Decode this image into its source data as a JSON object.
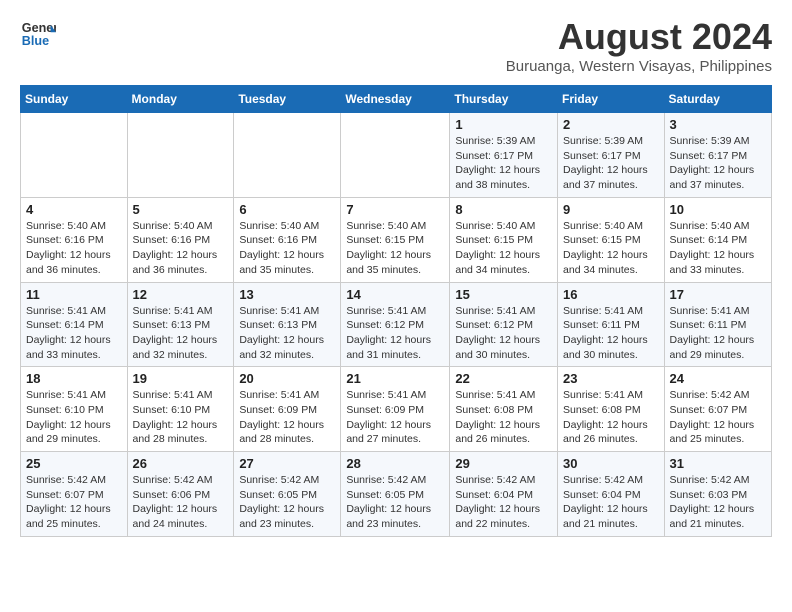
{
  "logo": {
    "line1": "General",
    "line2": "Blue"
  },
  "title": "August 2024",
  "subtitle": "Buruanga, Western Visayas, Philippines",
  "days_of_week": [
    "Sunday",
    "Monday",
    "Tuesday",
    "Wednesday",
    "Thursday",
    "Friday",
    "Saturday"
  ],
  "weeks": [
    [
      {
        "day": "",
        "info": ""
      },
      {
        "day": "",
        "info": ""
      },
      {
        "day": "",
        "info": ""
      },
      {
        "day": "",
        "info": ""
      },
      {
        "day": "1",
        "info": "Sunrise: 5:39 AM\nSunset: 6:17 PM\nDaylight: 12 hours\nand 38 minutes."
      },
      {
        "day": "2",
        "info": "Sunrise: 5:39 AM\nSunset: 6:17 PM\nDaylight: 12 hours\nand 37 minutes."
      },
      {
        "day": "3",
        "info": "Sunrise: 5:39 AM\nSunset: 6:17 PM\nDaylight: 12 hours\nand 37 minutes."
      }
    ],
    [
      {
        "day": "4",
        "info": "Sunrise: 5:40 AM\nSunset: 6:16 PM\nDaylight: 12 hours\nand 36 minutes."
      },
      {
        "day": "5",
        "info": "Sunrise: 5:40 AM\nSunset: 6:16 PM\nDaylight: 12 hours\nand 36 minutes."
      },
      {
        "day": "6",
        "info": "Sunrise: 5:40 AM\nSunset: 6:16 PM\nDaylight: 12 hours\nand 35 minutes."
      },
      {
        "day": "7",
        "info": "Sunrise: 5:40 AM\nSunset: 6:15 PM\nDaylight: 12 hours\nand 35 minutes."
      },
      {
        "day": "8",
        "info": "Sunrise: 5:40 AM\nSunset: 6:15 PM\nDaylight: 12 hours\nand 34 minutes."
      },
      {
        "day": "9",
        "info": "Sunrise: 5:40 AM\nSunset: 6:15 PM\nDaylight: 12 hours\nand 34 minutes."
      },
      {
        "day": "10",
        "info": "Sunrise: 5:40 AM\nSunset: 6:14 PM\nDaylight: 12 hours\nand 33 minutes."
      }
    ],
    [
      {
        "day": "11",
        "info": "Sunrise: 5:41 AM\nSunset: 6:14 PM\nDaylight: 12 hours\nand 33 minutes."
      },
      {
        "day": "12",
        "info": "Sunrise: 5:41 AM\nSunset: 6:13 PM\nDaylight: 12 hours\nand 32 minutes."
      },
      {
        "day": "13",
        "info": "Sunrise: 5:41 AM\nSunset: 6:13 PM\nDaylight: 12 hours\nand 32 minutes."
      },
      {
        "day": "14",
        "info": "Sunrise: 5:41 AM\nSunset: 6:12 PM\nDaylight: 12 hours\nand 31 minutes."
      },
      {
        "day": "15",
        "info": "Sunrise: 5:41 AM\nSunset: 6:12 PM\nDaylight: 12 hours\nand 30 minutes."
      },
      {
        "day": "16",
        "info": "Sunrise: 5:41 AM\nSunset: 6:11 PM\nDaylight: 12 hours\nand 30 minutes."
      },
      {
        "day": "17",
        "info": "Sunrise: 5:41 AM\nSunset: 6:11 PM\nDaylight: 12 hours\nand 29 minutes."
      }
    ],
    [
      {
        "day": "18",
        "info": "Sunrise: 5:41 AM\nSunset: 6:10 PM\nDaylight: 12 hours\nand 29 minutes."
      },
      {
        "day": "19",
        "info": "Sunrise: 5:41 AM\nSunset: 6:10 PM\nDaylight: 12 hours\nand 28 minutes."
      },
      {
        "day": "20",
        "info": "Sunrise: 5:41 AM\nSunset: 6:09 PM\nDaylight: 12 hours\nand 28 minutes."
      },
      {
        "day": "21",
        "info": "Sunrise: 5:41 AM\nSunset: 6:09 PM\nDaylight: 12 hours\nand 27 minutes."
      },
      {
        "day": "22",
        "info": "Sunrise: 5:41 AM\nSunset: 6:08 PM\nDaylight: 12 hours\nand 26 minutes."
      },
      {
        "day": "23",
        "info": "Sunrise: 5:41 AM\nSunset: 6:08 PM\nDaylight: 12 hours\nand 26 minutes."
      },
      {
        "day": "24",
        "info": "Sunrise: 5:42 AM\nSunset: 6:07 PM\nDaylight: 12 hours\nand 25 minutes."
      }
    ],
    [
      {
        "day": "25",
        "info": "Sunrise: 5:42 AM\nSunset: 6:07 PM\nDaylight: 12 hours\nand 25 minutes."
      },
      {
        "day": "26",
        "info": "Sunrise: 5:42 AM\nSunset: 6:06 PM\nDaylight: 12 hours\nand 24 minutes."
      },
      {
        "day": "27",
        "info": "Sunrise: 5:42 AM\nSunset: 6:05 PM\nDaylight: 12 hours\nand 23 minutes."
      },
      {
        "day": "28",
        "info": "Sunrise: 5:42 AM\nSunset: 6:05 PM\nDaylight: 12 hours\nand 23 minutes."
      },
      {
        "day": "29",
        "info": "Sunrise: 5:42 AM\nSunset: 6:04 PM\nDaylight: 12 hours\nand 22 minutes."
      },
      {
        "day": "30",
        "info": "Sunrise: 5:42 AM\nSunset: 6:04 PM\nDaylight: 12 hours\nand 21 minutes."
      },
      {
        "day": "31",
        "info": "Sunrise: 5:42 AM\nSunset: 6:03 PM\nDaylight: 12 hours\nand 21 minutes."
      }
    ]
  ]
}
